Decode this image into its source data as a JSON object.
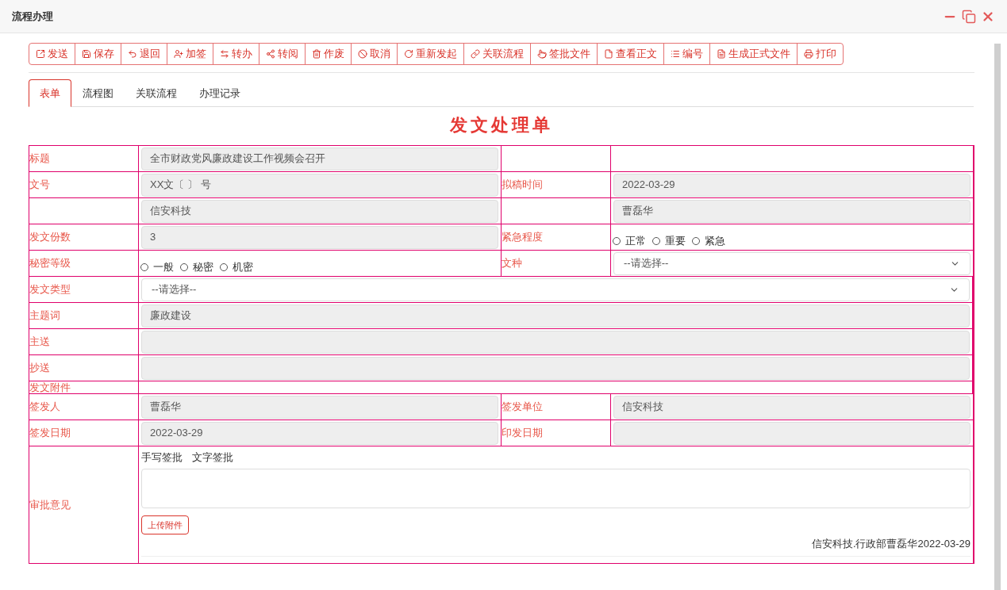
{
  "window": {
    "title": "流程办理"
  },
  "toolbar": [
    "发送",
    "保存",
    "退回",
    "加签",
    "转办",
    "转阅",
    "作废",
    "取消",
    "重新发起",
    "关联流程",
    "签批文件",
    "查看正文",
    "编号",
    "生成正式文件",
    "打印"
  ],
  "tabs": [
    {
      "label": "表单",
      "selected": true
    },
    {
      "label": "流程图",
      "selected": false
    },
    {
      "label": "关联流程",
      "selected": false
    },
    {
      "label": "办理记录",
      "selected": false
    }
  ],
  "heading": "发文处理单",
  "rows": [
    {
      "cells": [
        {
          "kind": "label",
          "text": "标题"
        },
        {
          "kind": "input",
          "value": "全市财政党风廉政建设工作视频会召开"
        },
        {
          "kind": "label"
        },
        {
          "kind": "blank"
        }
      ]
    },
    {
      "cells": [
        {
          "kind": "label",
          "text": "文号"
        },
        {
          "kind": "input",
          "value": "XX文〔  〕 号"
        },
        {
          "kind": "label",
          "text": "拟稿时间"
        },
        {
          "kind": "input",
          "value": "2022-03-29"
        }
      ]
    },
    {
      "cells": [
        {
          "kind": "label"
        },
        {
          "kind": "input",
          "value": "信安科技"
        },
        {
          "kind": "label"
        },
        {
          "kind": "input",
          "value": "曹磊华"
        }
      ]
    },
    {
      "cells": [
        {
          "kind": "label",
          "text": "发文份数"
        },
        {
          "kind": "input",
          "value": "3"
        },
        {
          "kind": "label",
          "text": "紧急程度"
        },
        {
          "kind": "radio",
          "options": [
            {
              "label": "正常",
              "selected": false
            },
            {
              "label": "重要",
              "selected": false
            },
            {
              "label": "紧急",
              "selected": false
            }
          ]
        }
      ]
    },
    {
      "cells": [
        {
          "kind": "label",
          "text": "秘密等级"
        },
        {
          "kind": "radio",
          "options": [
            {
              "label": "一般",
              "selected": false
            },
            {
              "label": "秘密",
              "selected": false
            },
            {
              "label": "机密",
              "selected": false
            }
          ]
        },
        {
          "kind": "label",
          "text": "文种"
        },
        {
          "kind": "select",
          "placeholder": "--请选择--"
        }
      ]
    },
    {
      "cells": [
        {
          "kind": "label",
          "text": "发文类型"
        },
        {
          "kind": "select",
          "placeholder": "--请选择--"
        }
      ]
    },
    {
      "cells": [
        {
          "kind": "label",
          "text": "主题词"
        },
        {
          "kind": "input",
          "value": "廉政建设"
        }
      ]
    },
    {
      "cells": [
        {
          "kind": "label",
          "text": "主送"
        },
        {
          "kind": "input"
        }
      ]
    },
    {
      "cells": [
        {
          "kind": "label",
          "text": "抄送"
        },
        {
          "kind": "input"
        }
      ]
    },
    {
      "cells": [
        {
          "kind": "label",
          "text": "发文附件"
        },
        {
          "kind": "blank"
        }
      ]
    },
    {
      "cells": [
        {
          "kind": "label",
          "text": "签发人"
        },
        {
          "kind": "input",
          "value": "曹磊华"
        },
        {
          "kind": "label",
          "text": "签发单位"
        },
        {
          "kind": "input",
          "value": "信安科技"
        }
      ]
    },
    {
      "cells": [
        {
          "kind": "label",
          "text": "签发日期"
        },
        {
          "kind": "input",
          "value": "2022-03-29"
        },
        {
          "kind": "label",
          "text": "印发日期"
        },
        {
          "kind": "input"
        }
      ]
    }
  ],
  "approval": {
    "label": "审批意见",
    "modes": [
      "手写签批",
      "文字签批"
    ],
    "upload_button": "上传附件",
    "signature": "信安科技.行政部曹磊华2022-03-29"
  }
}
